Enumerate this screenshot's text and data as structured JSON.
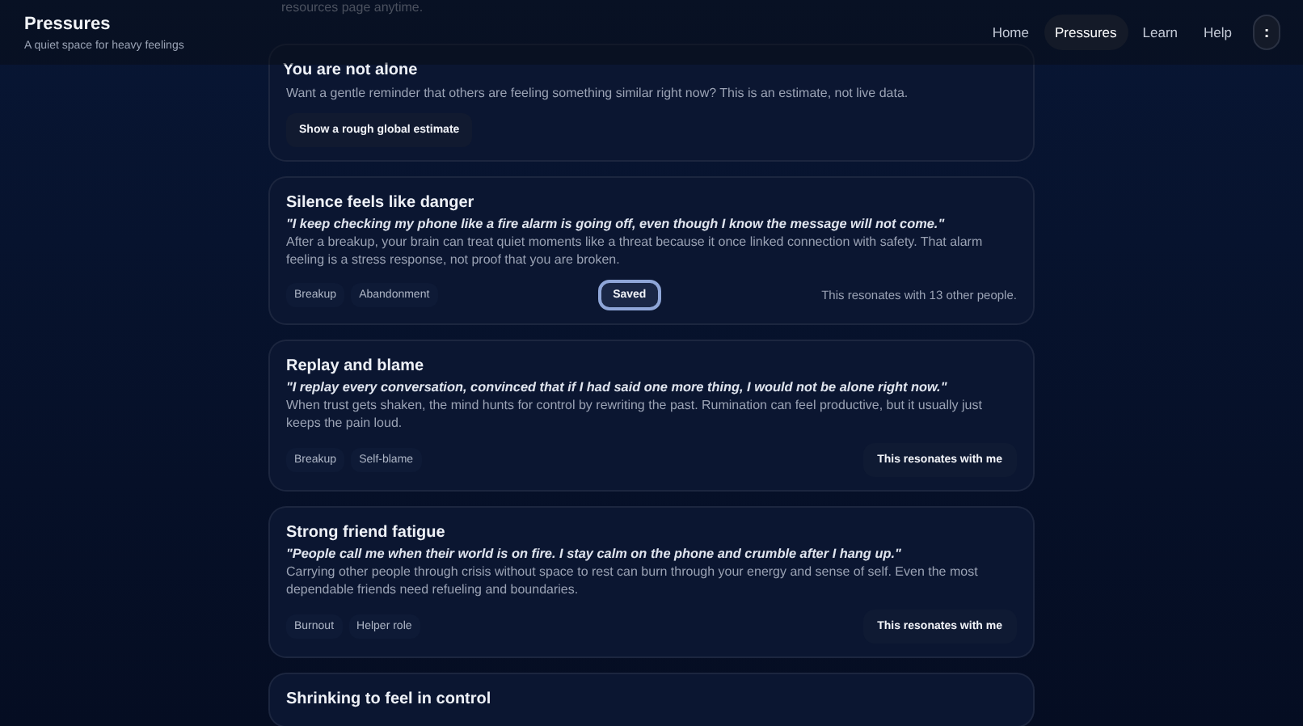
{
  "header": {
    "title": "Pressures",
    "subtitle": "A quiet space for heavy feelings",
    "nav": [
      {
        "label": "Home",
        "selected": false
      },
      {
        "label": "Pressures",
        "selected": true
      },
      {
        "label": "Learn",
        "selected": false
      },
      {
        "label": "Help",
        "selected": false
      }
    ],
    "menu_button": ":"
  },
  "intro_tail": "resources page anytime.",
  "estimate_card": {
    "title": "You are not alone",
    "text": "Want a gentle reminder that others are feeling something similar right now? This is an estimate, not live data.",
    "button": "Show a rough global estimate"
  },
  "pressures": [
    {
      "title": "Silence feels like danger",
      "quote": "\"I keep checking my phone like a fire alarm is going off, even though I know the message will not come.\"",
      "text": "After a breakup, your brain can treat quiet moments like a threat because it once linked connection with safety. That alarm feeling is a stress response, not proof that you are broken.",
      "tags": [
        "Breakup",
        "Abandonment"
      ],
      "button": "Saved",
      "saved": true,
      "resonance": "This resonates with 13 other people."
    },
    {
      "title": "Replay and blame",
      "quote": "\"I replay every conversation, convinced that if I had said one more thing, I would not be alone right now.\"",
      "text": "When trust gets shaken, the mind hunts for control by rewriting the past. Rumination can feel productive, but it usually just keeps the pain loud.",
      "tags": [
        "Breakup",
        "Self-blame"
      ],
      "button": "This resonates with me",
      "saved": false
    },
    {
      "title": "Strong friend fatigue",
      "quote": "\"People call me when their world is on fire. I stay calm on the phone and crumble after I hang up.\"",
      "text": "Carrying other people through crisis without space to rest can burn through your energy and sense of self. Even the most dependable friends need refueling and boundaries.",
      "tags": [
        "Burnout",
        "Helper role"
      ],
      "button": "This resonates with me",
      "saved": false
    },
    {
      "title": "Shrinking to feel in control"
    }
  ]
}
